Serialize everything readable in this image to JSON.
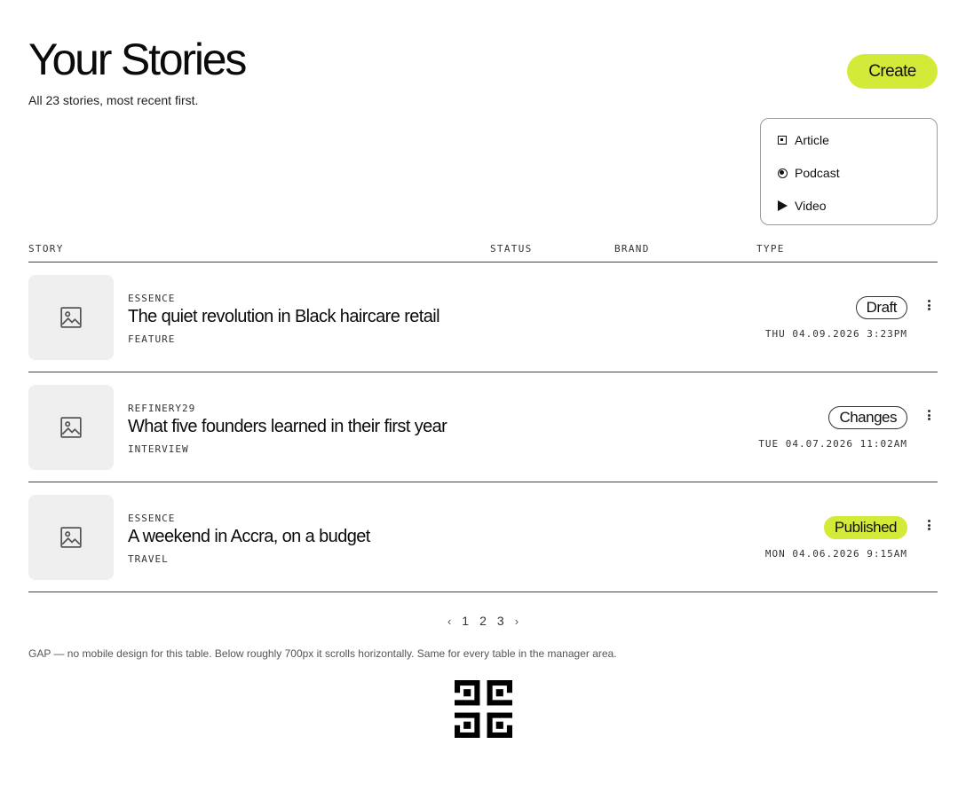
{
  "header": {
    "title": "Your Stories",
    "subtitle": "All 23 stories, most recent first.",
    "create_label": "Create"
  },
  "create_menu": {
    "items": [
      {
        "label": "Article",
        "icon": "article-icon"
      },
      {
        "label": "Podcast",
        "icon": "podcast-icon"
      },
      {
        "label": "Video",
        "icon": "video-icon"
      }
    ]
  },
  "table": {
    "columns": [
      "STORY",
      "STATUS",
      "BRAND",
      "TYPE"
    ],
    "rows": [
      {
        "brand": "ESSENCE",
        "title": "The quiet revolution in Black haircare retail",
        "category": "FEATURE",
        "status": "Draft",
        "date": "THU 04.09.2026 3:23PM"
      },
      {
        "brand": "REFINERY29",
        "title": "What five founders learned in their first year",
        "category": "INTERVIEW",
        "status": "Changes",
        "date": "TUE 04.07.2026 11:02AM"
      },
      {
        "brand": "ESSENCE",
        "title": "A weekend in Accra, on a budget",
        "category": "TRAVEL",
        "status": "Published",
        "date": "MON 04.06.2026 9:15AM"
      }
    ]
  },
  "pagination": {
    "prev": "‹",
    "pages": [
      "1",
      "2",
      "3"
    ],
    "next": "›"
  },
  "note": "GAP — no mobile design for this table. Below roughly 700px it scrolls horizontally. Same for every table in the manager area.",
  "colors": {
    "accent": "#d4ea39",
    "thumb_bg": "#efefef"
  }
}
